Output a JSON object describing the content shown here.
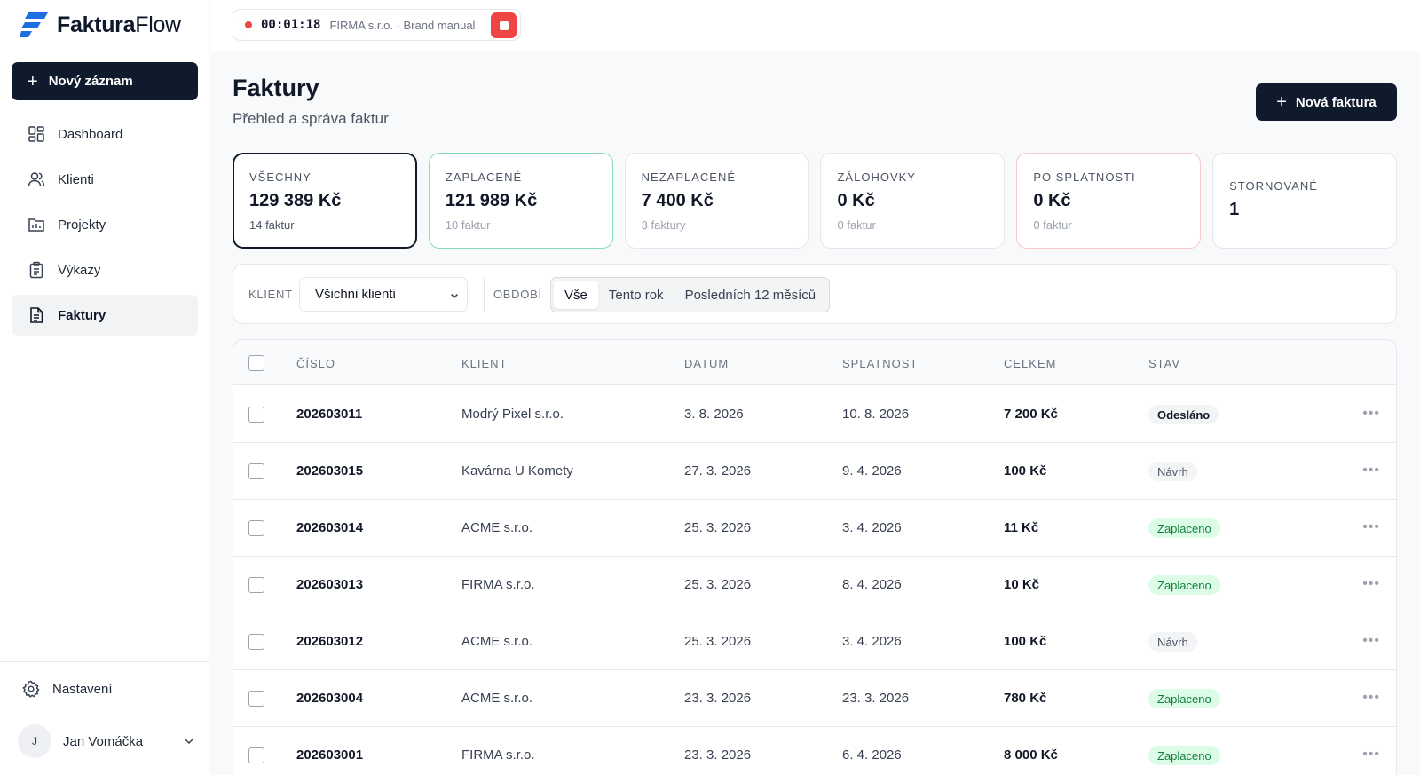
{
  "app": {
    "logo_part1": "Faktura",
    "logo_part2": "Flow",
    "new_record_label": "Nový záznam",
    "nav": [
      {
        "label": "Dashboard",
        "icon": "dashboard-icon",
        "active": false
      },
      {
        "label": "Klienti",
        "icon": "users-icon",
        "active": false
      },
      {
        "label": "Projekty",
        "icon": "projects-icon",
        "active": false
      },
      {
        "label": "Výkazy",
        "icon": "clipboard-icon",
        "active": false
      },
      {
        "label": "Faktury",
        "icon": "invoice-icon",
        "active": true
      }
    ],
    "settings_label": "Nastavení",
    "user": {
      "initial": "J",
      "name": "Jan Vomáčka"
    }
  },
  "timer": {
    "time": "00:01:18",
    "label": "FIRMA s.r.o. · Brand manual"
  },
  "header": {
    "title": "Faktury",
    "subtitle": "Přehled a správa faktur",
    "new_invoice_label": "Nová faktura"
  },
  "stats": [
    {
      "label": "VŠECHNY",
      "value": "129 389 Kč",
      "count": "14 faktur"
    },
    {
      "label": "ZAPLACENÉ",
      "value": "121 989 Kč",
      "count": "10 faktur"
    },
    {
      "label": "NEZAPLACENÉ",
      "value": "7 400 Kč",
      "count": "3 faktury"
    },
    {
      "label": "ZÁLOHOVKY",
      "value": "0 Kč",
      "count": "0 faktur"
    },
    {
      "label": "PO SPLATNOSTI",
      "value": "0 Kč",
      "count": "0 faktur"
    },
    {
      "label": "STORNOVANÉ",
      "value": "1"
    }
  ],
  "filters": {
    "client_label": "KLIENT",
    "client_value": "Všichni klienti",
    "period_label": "OBDOBÍ",
    "period_options": [
      "Vše",
      "Tento rok",
      "Posledních 12 měsíců"
    ],
    "period_selected": "Vše"
  },
  "table": {
    "columns": [
      "ČÍSLO",
      "KLIENT",
      "DATUM",
      "SPLATNOST",
      "CELKEM",
      "STAV"
    ],
    "rows": [
      {
        "number": "202603011",
        "client": "Modrý Pixel s.r.o.",
        "date": "3. 8. 2026",
        "due": "10. 8. 2026",
        "total": "7 200 Kč",
        "status": "Odesláno"
      },
      {
        "number": "202603015",
        "client": "Kavárna U Komety",
        "date": "27. 3. 2026",
        "due": "9. 4. 2026",
        "total": "100 Kč",
        "status": "Návrh"
      },
      {
        "number": "202603014",
        "client": "ACME s.r.o.",
        "date": "25. 3. 2026",
        "due": "3. 4. 2026",
        "total": "11 Kč",
        "status": "Zaplaceno"
      },
      {
        "number": "202603013",
        "client": "FIRMA s.r.o.",
        "date": "25. 3. 2026",
        "due": "8. 4. 2026",
        "total": "10 Kč",
        "status": "Zaplaceno"
      },
      {
        "number": "202603012",
        "client": "ACME s.r.o.",
        "date": "25. 3. 2026",
        "due": "3. 4. 2026",
        "total": "100 Kč",
        "status": "Návrh"
      },
      {
        "number": "202603004",
        "client": "ACME s.r.o.",
        "date": "23. 3. 2026",
        "due": "23. 3. 2026",
        "total": "780 Kč",
        "status": "Zaplaceno"
      },
      {
        "number": "202603001",
        "client": "FIRMA s.r.o.",
        "date": "23. 3. 2026",
        "due": "6. 4. 2026",
        "total": "8 000 Kč",
        "status": "Zaplaceno"
      }
    ]
  },
  "colors": {
    "primary": "#0f1b2d",
    "accent_blue": "#1d6fe0",
    "paid_border": "#86dac0",
    "overdue_border": "#f6c9cc",
    "paid_badge_bg": "#dcfce7",
    "paid_badge_text": "#15803d",
    "recording": "#ef4444"
  }
}
